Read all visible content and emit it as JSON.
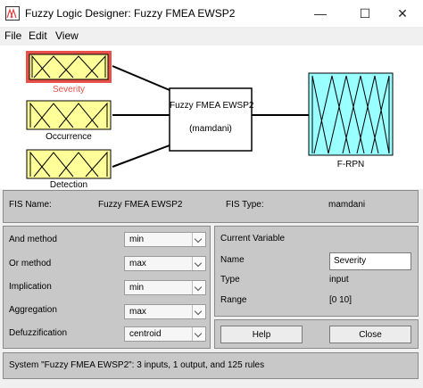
{
  "window": {
    "title": "Fuzzy Logic Designer: Fuzzy FMEA EWSP2",
    "minimize_glyph": "—",
    "maximize_glyph": "☐",
    "close_glyph": "✕"
  },
  "menu": {
    "items": [
      "File",
      "Edit",
      "View"
    ]
  },
  "diagram": {
    "inputs": [
      "Severity",
      "Occurrence",
      "Detection"
    ],
    "system_name": "Fuzzy FMEA EWSP2",
    "system_type": "(mamdani)",
    "output": "F-RPN",
    "colors": {
      "input": "#ffff99",
      "output": "#99ffff",
      "selected": "#e8504a"
    }
  },
  "fis": {
    "name_label": "FIS Name:",
    "name_value": "Fuzzy FMEA EWSP2",
    "type_label": "FIS Type:",
    "type_value": "mamdani"
  },
  "methods": [
    {
      "label": "And method",
      "value": "min"
    },
    {
      "label": "Or method",
      "value": "max"
    },
    {
      "label": "Implication",
      "value": "min"
    },
    {
      "label": "Aggregation",
      "value": "max"
    },
    {
      "label": "Defuzzification",
      "value": "centroid"
    }
  ],
  "current_variable": {
    "heading": "Current Variable",
    "name_label": "Name",
    "name_value": "Severity",
    "type_label": "Type",
    "type_value": "input",
    "range_label": "Range",
    "range_value": "[0 10]"
  },
  "buttons": {
    "help": "Help",
    "close": "Close"
  },
  "status": "System \"Fuzzy FMEA EWSP2\": 3 inputs, 1 output, and 125 rules"
}
